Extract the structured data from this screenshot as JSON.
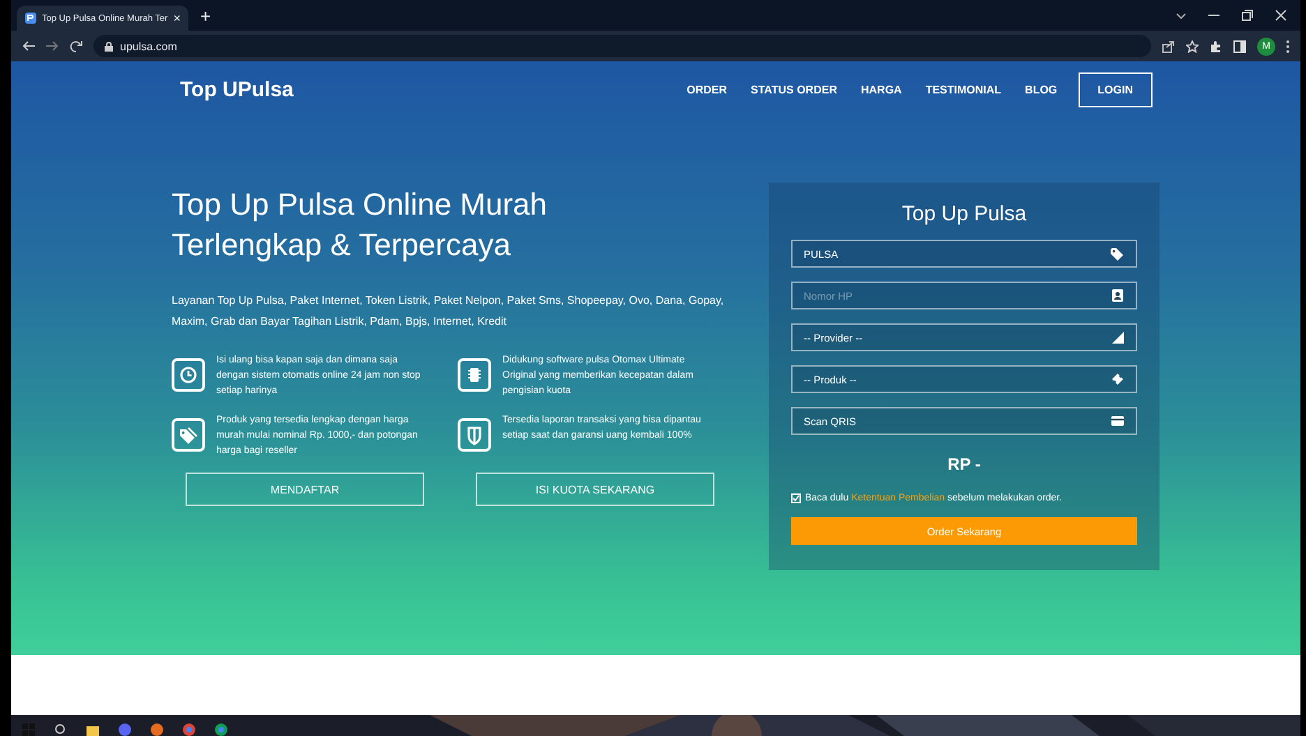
{
  "browser": {
    "tab": {
      "title": "Top Up Pulsa Online Murah Ter",
      "close": "×"
    },
    "new_tab": "+",
    "url": "upulsa.com",
    "profile": "M"
  },
  "nav": {
    "brand": "Top UPulsa",
    "items": [
      {
        "label": "ORDER",
        "kind": "link"
      },
      {
        "label": "STATUS ORDER",
        "kind": "link"
      },
      {
        "label": "HARGA",
        "kind": "link"
      },
      {
        "label": "TESTIMONIAL",
        "kind": "link"
      },
      {
        "label": "BLOG",
        "kind": "link"
      },
      {
        "label": "LOGIN",
        "kind": "button"
      }
    ]
  },
  "hero": {
    "title_lines": [
      "Top Up Pulsa Online Murah",
      "Terlengkap & Terpercaya"
    ],
    "description": "Layanan Top Up Pulsa, Paket Internet, Token Listrik, Paket Nelpon, Paket Sms, Shopeepay, Ovo, Dana, Gopay, Maxim, Grab dan Bayar Tagihan Listrik, Pdam, Bpjs, Internet, Kredit",
    "features": [
      {
        "text": "Isi ulang bisa kapan saja dan dimana saja dengan sistem otomatis online 24 jam non stop setiap harinya"
      },
      {
        "text": "Didukung software pulsa Otomax Ultimate Original yang memberikan kecepatan dalam pengisian kuota"
      },
      {
        "text": "Produk yang tersedia lengkap dengan harga murah mulai nominal Rp. 1000,- dan potongan harga bagi reseller"
      },
      {
        "text": "Tersedia laporan transaksi yang bisa dipantau setiap saat dan garansi uang kembali 100%"
      }
    ],
    "buttons": [
      "MENDAFTAR",
      "ISI KUOTA SEKARANG"
    ]
  },
  "form": {
    "title": "Top Up Pulsa",
    "fields": [
      {
        "kind": "select",
        "value": "PULSA"
      },
      {
        "kind": "input",
        "placeholder": "Nomor HP"
      },
      {
        "kind": "select",
        "value": "-- Provider --"
      },
      {
        "kind": "select",
        "value": "-- Produk --"
      },
      {
        "kind": "select",
        "value": "Scan QRIS"
      }
    ],
    "price": "RP -",
    "agreement": {
      "checked": true,
      "before": "Baca dulu",
      "link": "Ketentuan Pembelian",
      "after": "sebelum melakukan order."
    },
    "submit": "Order Sekarang"
  }
}
